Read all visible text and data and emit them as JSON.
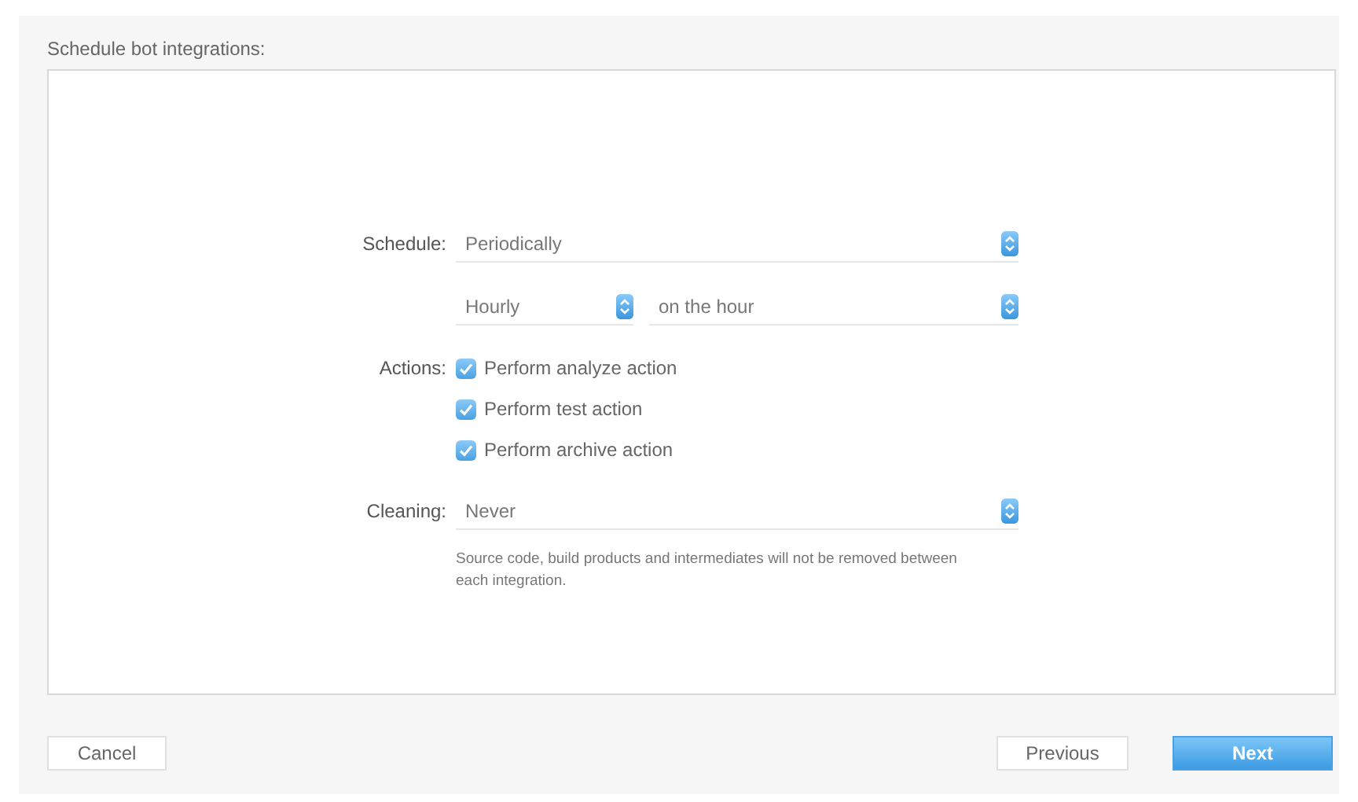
{
  "title": "Schedule bot integrations:",
  "schedule": {
    "label": "Schedule:",
    "value": "Periodically",
    "period": "Hourly",
    "offset": "on the hour"
  },
  "actions": {
    "label": "Actions:",
    "items": [
      {
        "label": "Perform analyze action",
        "checked": true
      },
      {
        "label": "Perform test action",
        "checked": true
      },
      {
        "label": "Perform archive action",
        "checked": true
      }
    ]
  },
  "cleaning": {
    "label": "Cleaning:",
    "value": "Never",
    "hint": "Source code, build products and intermediates will not be removed between each integration."
  },
  "buttons": [
    {
      "label": "Cancel",
      "kind": "plain"
    },
    {
      "label": "Previous",
      "kind": "plain"
    },
    {
      "label": "Next",
      "kind": "primary"
    }
  ]
}
